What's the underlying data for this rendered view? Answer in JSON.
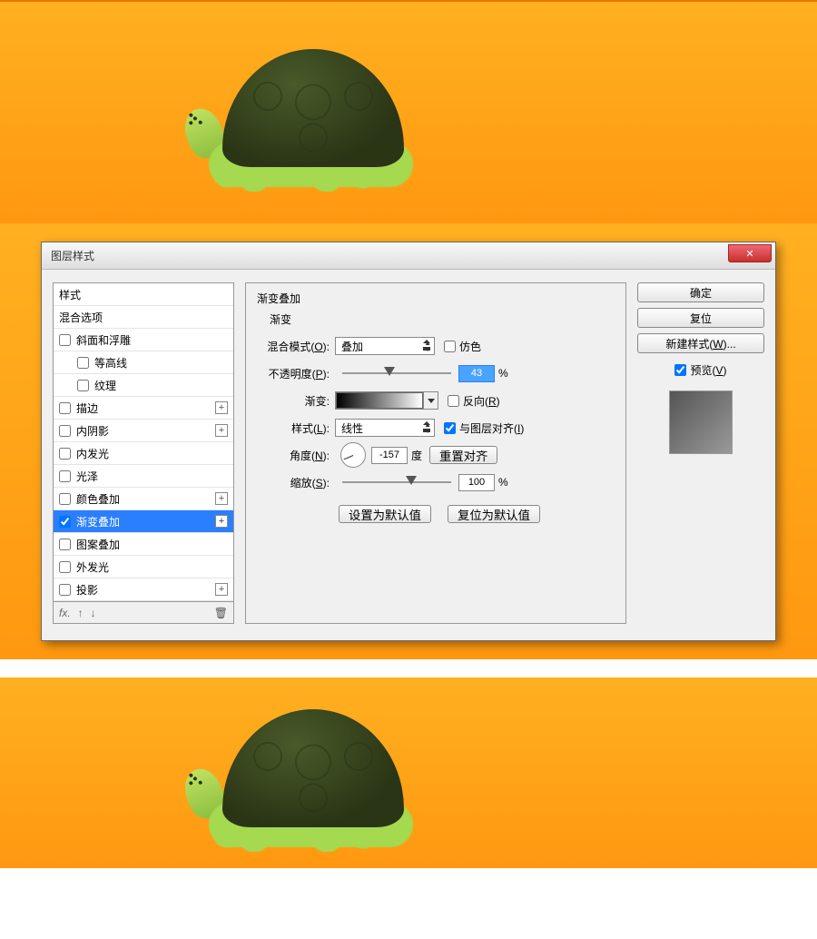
{
  "dialog": {
    "title": "图层样式",
    "close_icon": "✕",
    "section_title": "渐变叠加",
    "group_label": "渐变",
    "styles_header": "样式",
    "blend_options": "混合选项",
    "items": [
      {
        "label": "斜面和浮雕",
        "checked": false,
        "plus": false,
        "indent": false
      },
      {
        "label": "等高线",
        "checked": false,
        "plus": false,
        "indent": true
      },
      {
        "label": "纹理",
        "checked": false,
        "plus": false,
        "indent": true
      },
      {
        "label": "描边",
        "checked": false,
        "plus": true,
        "indent": false
      },
      {
        "label": "内阴影",
        "checked": false,
        "plus": true,
        "indent": false
      },
      {
        "label": "内发光",
        "checked": false,
        "plus": false,
        "indent": false
      },
      {
        "label": "光泽",
        "checked": false,
        "plus": false,
        "indent": false
      },
      {
        "label": "颜色叠加",
        "checked": false,
        "plus": true,
        "indent": false
      },
      {
        "label": "渐变叠加",
        "checked": true,
        "plus": true,
        "indent": false,
        "selected": true
      },
      {
        "label": "图案叠加",
        "checked": false,
        "plus": false,
        "indent": false
      },
      {
        "label": "外发光",
        "checked": false,
        "plus": false,
        "indent": false
      },
      {
        "label": "投影",
        "checked": false,
        "plus": true,
        "indent": false
      }
    ],
    "footer_fx": "fx.",
    "form": {
      "blend_mode_label": "混合模式(O):",
      "blend_mode_value": "叠加",
      "dither_label": "仿色",
      "opacity_label": "不透明度(P):",
      "opacity_value": "43",
      "percent": "%",
      "gradient_label": "渐变:",
      "reverse_label": "反向(R)",
      "style_label": "样式(L):",
      "style_value": "线性",
      "align_label": "与图层对齐(I)",
      "angle_label": "角度(N):",
      "angle_value": "-157",
      "angle_unit": "度",
      "reset_align": "重置对齐",
      "scale_label": "缩放(S):",
      "scale_value": "100",
      "set_default": "设置为默认值",
      "reset_default": "复位为默认值"
    },
    "buttons": {
      "ok": "确定",
      "cancel": "复位",
      "new_style": "新建样式(W)...",
      "preview": "预览(V)"
    }
  },
  "chart_data": null
}
